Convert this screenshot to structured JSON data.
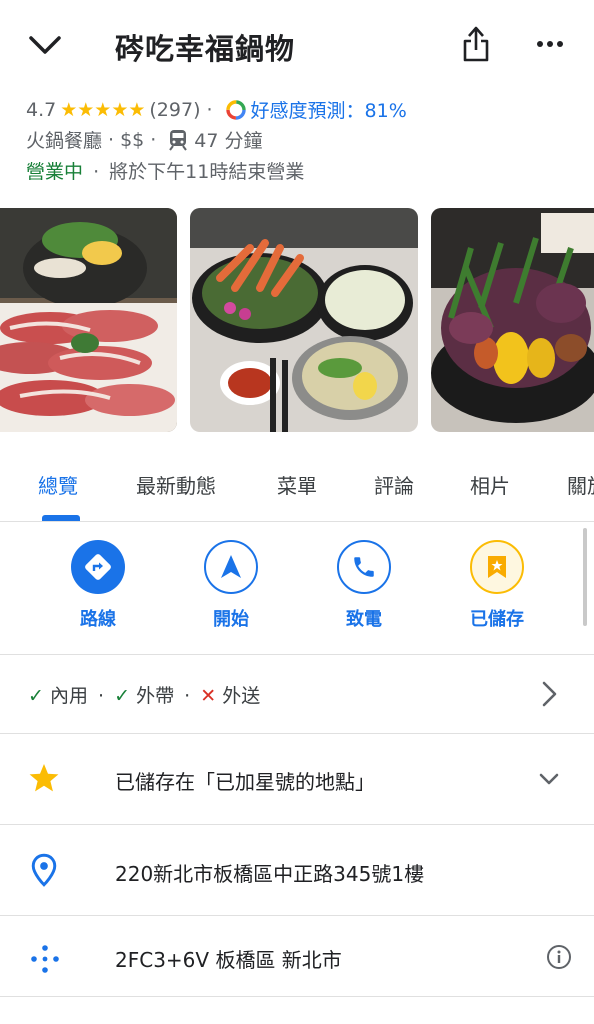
{
  "place": {
    "title": "硶吃幸福鍋物",
    "rating": "4.7",
    "stars": "★★★★★",
    "reviews": "(297)",
    "sep": "·",
    "match_label": "好感度預測：81%",
    "category": "火鍋餐廳",
    "price": "$$",
    "transit": "47 分鐘",
    "open_status": "營業中",
    "hours": "將於下午11時結束營業"
  },
  "tabs": [
    {
      "label": "總覽",
      "active": true
    },
    {
      "label": "最新動態"
    },
    {
      "label": "菜單"
    },
    {
      "label": "評論"
    },
    {
      "label": "相片"
    },
    {
      "label": "關於"
    }
  ],
  "actions": [
    {
      "label": "路線",
      "icon": "directions-icon"
    },
    {
      "label": "開始",
      "icon": "navigation-icon"
    },
    {
      "label": "致電",
      "icon": "phone-icon"
    },
    {
      "label": "已儲存",
      "icon": "saved-bookmark-icon"
    }
  ],
  "services": {
    "dine_in": "內用",
    "takeout": "外帶",
    "delivery": "外送",
    "sep": "·",
    "check": "✓",
    "cross": "✕"
  },
  "saved_text": "已儲存在「已加星號的地點」",
  "address": "220新北市板橋區中正路345號1樓",
  "plus_code": "2FC3+6V 板橋區 新北市",
  "colors": {
    "accent": "#1a73e8",
    "star": "#fbbc04",
    "open": "#188038",
    "no": "#d93025"
  }
}
